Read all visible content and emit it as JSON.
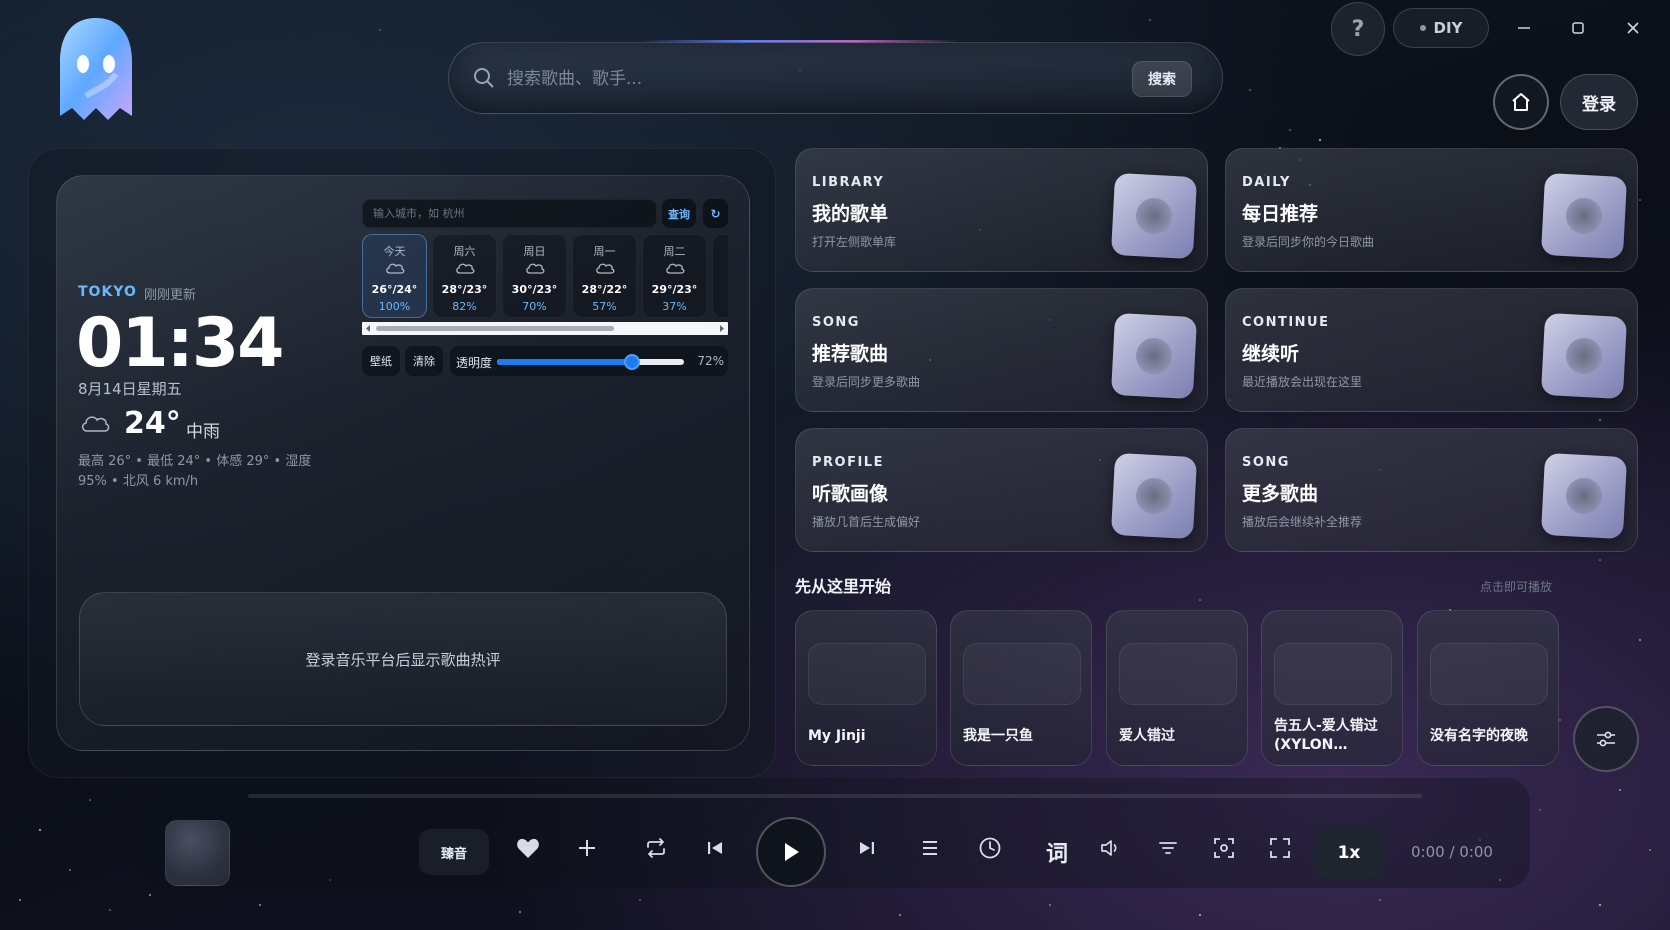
{
  "search": {
    "placeholder": "搜索歌曲、歌手...",
    "button_label": "搜索"
  },
  "topbar": {
    "help_label": "?",
    "diy_label": "DIY",
    "login_label": "登录"
  },
  "weather": {
    "city": "TOKYO",
    "updated": "刚刚更新",
    "time": "01:34",
    "date": "8月14日星期五",
    "temp": "24°",
    "condition": "中雨",
    "detail": "最高 26° • 最低 24° • 体感 29° • 湿度 95% • 北风 6 km/h",
    "city_input_placeholder": "输入城市，如 杭州",
    "query_label": "查询",
    "refresh_label": "↻",
    "forecast": [
      {
        "day": "今天",
        "temp": "26°/24°",
        "humidity": "100%"
      },
      {
        "day": "周六",
        "temp": "28°/23°",
        "humidity": "82%"
      },
      {
        "day": "周日",
        "temp": "30°/23°",
        "humidity": "70%"
      },
      {
        "day": "周一",
        "temp": "28°/22°",
        "humidity": "57%"
      },
      {
        "day": "周二",
        "temp": "29°/23°",
        "humidity": "37%"
      }
    ],
    "wallpaper_label": "壁纸",
    "clear_label": "清除",
    "opacity_label": "透明度",
    "opacity_value": "72%",
    "opacity_fraction": 0.72,
    "comments_text": "登录音乐平台后显示歌曲热评"
  },
  "features": [
    {
      "tag": "LIBRARY",
      "title": "我的歌单",
      "sub": "打开左侧歌单库"
    },
    {
      "tag": "DAILY",
      "title": "每日推荐",
      "sub": "登录后同步你的今日歌曲"
    },
    {
      "tag": "SONG",
      "title": "推荐歌曲",
      "sub": "登录后同步更多歌曲"
    },
    {
      "tag": "CONTINUE",
      "title": "继续听",
      "sub": "最近播放会出现在这里"
    },
    {
      "tag": "PROFILE",
      "title": "听歌画像",
      "sub": "播放几首后生成偏好"
    },
    {
      "tag": "SONG",
      "title": "更多歌曲",
      "sub": "播放后会继续补全推荐"
    }
  ],
  "start": {
    "title": "先从这里开始",
    "hint": "点击即可播放",
    "songs": [
      "My Jinji",
      "我是一只鱼",
      "爱人错过",
      "告五人-爱人错过 (XYLON…",
      "没有名字的夜晚"
    ]
  },
  "player": {
    "quality_label": "臻音",
    "lyric_label": "词",
    "speed_label": "1x",
    "time": "0:00 / 0:00"
  },
  "colors": {
    "accent": "#69b9ff",
    "slider": "#1e7cf2",
    "card_disc": "#9ea0c8"
  }
}
